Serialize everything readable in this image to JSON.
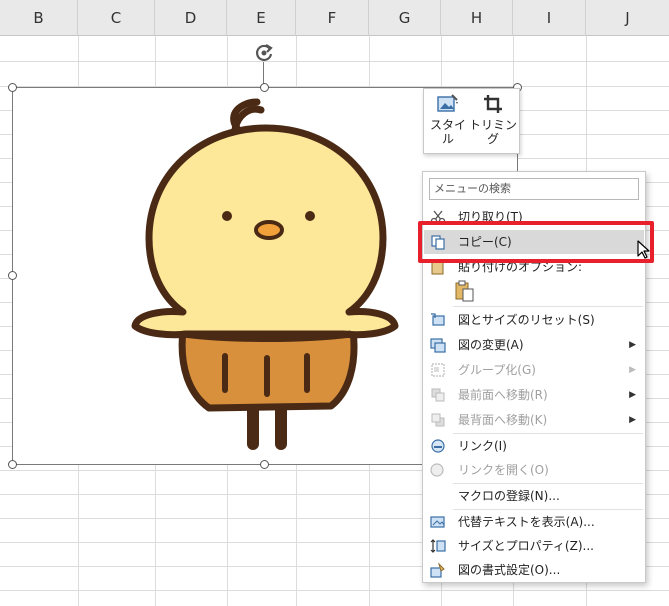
{
  "columns": [
    "B",
    "C",
    "D",
    "E",
    "F",
    "G",
    "H",
    "I",
    "J"
  ],
  "mini_toolbar": {
    "style_label_1": "スタイ",
    "style_label_2": "ル",
    "trim_label": "トリミング"
  },
  "context_menu": {
    "search_placeholder": "メニューの検索",
    "items": [
      {
        "label": "切り取り(T)",
        "icon": "scissors-icon",
        "enabled": true
      },
      {
        "label": "コピー(C)",
        "icon": "copy-icon",
        "enabled": true
      },
      {
        "label": "貼り付けのオプション:",
        "icon": "paste-icon",
        "enabled": true
      },
      {
        "label": "図とサイズのリセット(S)",
        "icon": "reset-picture-icon",
        "enabled": true
      },
      {
        "label": "図の変更(A)",
        "icon": "change-picture-icon",
        "enabled": true
      },
      {
        "label": "グループ化(G)",
        "icon": "group-icon",
        "enabled": false
      },
      {
        "label": "最前面へ移動(R)",
        "icon": "bring-to-front-icon",
        "enabled": false
      },
      {
        "label": "最背面へ移動(K)",
        "icon": "send-to-back-icon",
        "enabled": false
      },
      {
        "label": "リンク(I)",
        "icon": "link-icon",
        "enabled": true
      },
      {
        "label": "リンクを開く(O)",
        "icon": "open-link-icon",
        "enabled": false
      },
      {
        "label": "マクロの登録(N)...",
        "icon": "",
        "enabled": true
      },
      {
        "label": "代替テキストを表示(A)...",
        "icon": "alt-text-icon",
        "enabled": true
      },
      {
        "label": "サイズとプロパティ(Z)...",
        "icon": "size-properties-icon",
        "enabled": true
      },
      {
        "label": "図の書式設定(O)...",
        "icon": "format-picture-icon",
        "enabled": true
      }
    ]
  },
  "colors": {
    "highlight": "#e8202b",
    "chick_body": "#fde89a",
    "chick_skirt": "#d9903c",
    "outline": "#4a2a14"
  }
}
